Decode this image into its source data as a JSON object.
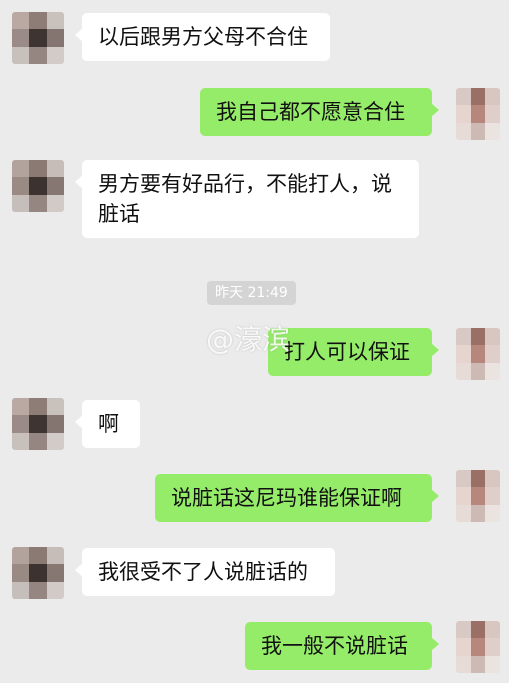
{
  "messages": [
    {
      "side": "in",
      "text": "以后跟男方父母不合住"
    },
    {
      "side": "out",
      "text": "我自己都不愿意合住"
    },
    {
      "side": "in",
      "text": "男方要有好品行，不能打人，说脏话"
    },
    {
      "side": "out",
      "text": "打人可以保证"
    },
    {
      "side": "in",
      "text": "啊"
    },
    {
      "side": "out",
      "text": "说脏话这尼玛谁能保证啊"
    },
    {
      "side": "in",
      "text": "我很受不了人说脏话的"
    },
    {
      "side": "out",
      "text": "我一般不说脏话"
    }
  ],
  "timestamp": "昨天 21:49",
  "watermark": "@濠滨",
  "colors": {
    "background": "#ebebeb",
    "incoming_bubble": "#ffffff",
    "outgoing_bubble": "#95ec69"
  },
  "avatars": {
    "left": "pixelated-avatar",
    "right": "pixelated-avatar"
  }
}
